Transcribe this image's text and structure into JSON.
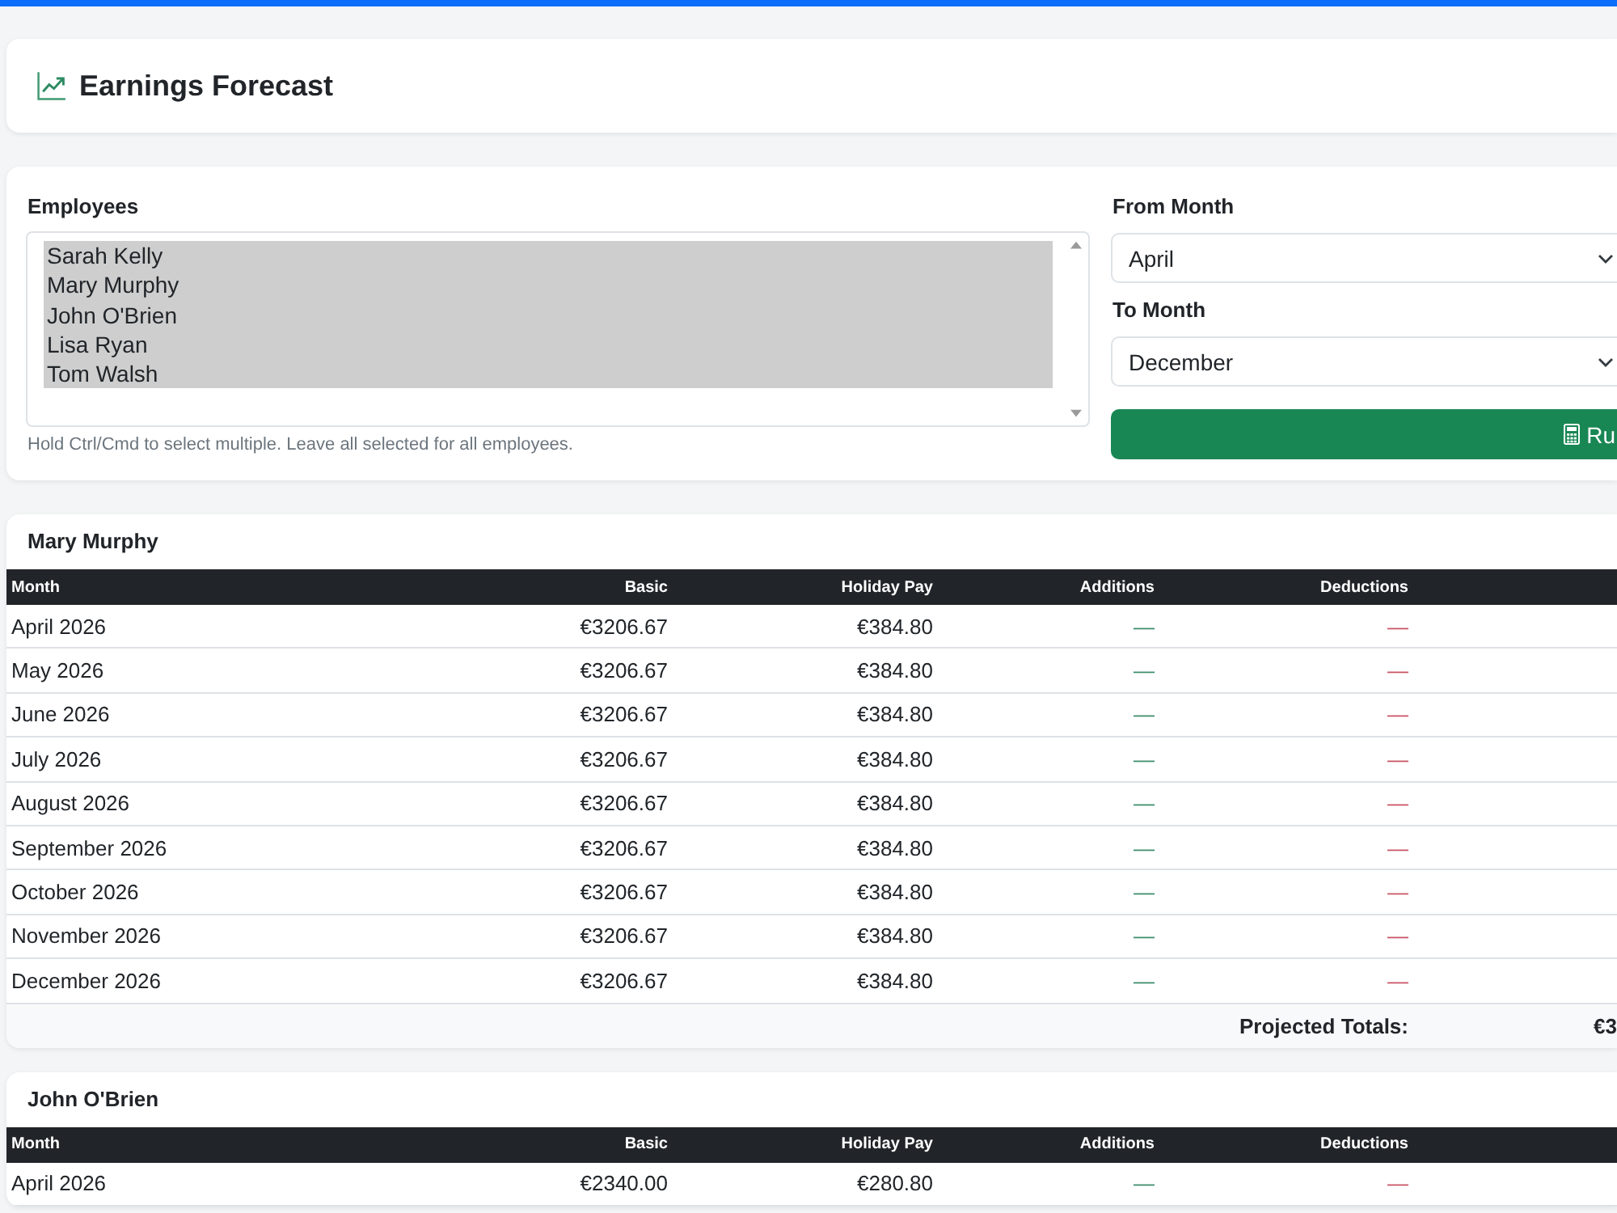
{
  "header": {
    "title": "Earnings Forecast"
  },
  "filters": {
    "employees": {
      "label": "Employees",
      "options": [
        {
          "name": "Sarah Kelly",
          "selected": true
        },
        {
          "name": "Mary Murphy",
          "selected": true
        },
        {
          "name": "John O'Brien",
          "selected": true
        },
        {
          "name": "Lisa Ryan",
          "selected": true
        },
        {
          "name": "Tom Walsh",
          "selected": true
        }
      ],
      "hint": "Hold Ctrl/Cmd to select multiple. Leave all selected for all employees."
    },
    "from_month": {
      "label": "From Month",
      "value": "April"
    },
    "to_month": {
      "label": "To Month",
      "value": "December"
    },
    "run_button": {
      "label": "Ru"
    }
  },
  "forecasts": [
    {
      "employee": "Mary Murphy",
      "columns": [
        "Month",
        "Basic",
        "Holiday Pay",
        "Additions",
        "Deductions"
      ],
      "rows": [
        [
          "April 2026",
          "€3206.67",
          "€384.80",
          "—",
          "—"
        ],
        [
          "May 2026",
          "€3206.67",
          "€384.80",
          "—",
          "—"
        ],
        [
          "June 2026",
          "€3206.67",
          "€384.80",
          "—",
          "—"
        ],
        [
          "July 2026",
          "€3206.67",
          "€384.80",
          "—",
          "—"
        ],
        [
          "August 2026",
          "€3206.67",
          "€384.80",
          "—",
          "—"
        ],
        [
          "September 2026",
          "€3206.67",
          "€384.80",
          "—",
          "—"
        ],
        [
          "October 2026",
          "€3206.67",
          "€384.80",
          "—",
          "—"
        ],
        [
          "November 2026",
          "€3206.67",
          "€384.80",
          "—",
          "—"
        ],
        [
          "December 2026",
          "€3206.67",
          "€384.80",
          "—",
          "—"
        ]
      ],
      "totals": {
        "label": "Projected Totals:",
        "values": [
          "€3"
        ]
      }
    },
    {
      "employee": "John O'Brien",
      "columns": [
        "Month",
        "Basic",
        "Holiday Pay",
        "Additions",
        "Deductions"
      ],
      "rows": [
        [
          "April 2026",
          "€2340.00",
          "€280.80",
          "—",
          "—"
        ]
      ]
    }
  ]
}
